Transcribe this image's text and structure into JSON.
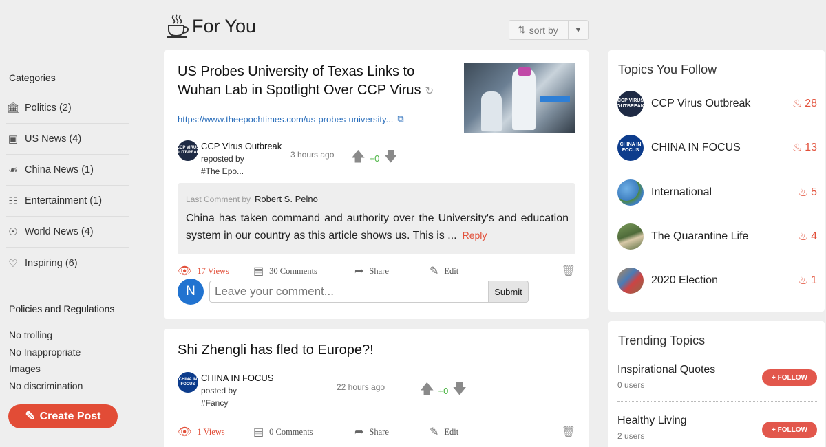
{
  "header": {
    "title": "For You",
    "sort_label": "sort by"
  },
  "sidebar": {
    "categories_title": "Categories",
    "categories": [
      {
        "label": "Politics (2)",
        "icon": "capitol-icon"
      },
      {
        "label": "US News (4)",
        "icon": "newspaper-icon"
      },
      {
        "label": "China News (1)",
        "icon": "chinese-map-icon"
      },
      {
        "label": "Entertainment (1)",
        "icon": "popcorn-icon"
      },
      {
        "label": "World News (4)",
        "icon": "globe-icon"
      },
      {
        "label": "Inspiring (6)",
        "icon": "heart-hand-icon"
      }
    ],
    "policies_title": "Policies and Regulations",
    "policies": [
      "No trolling",
      "No Inappropriate",
      "Images",
      "No discrimination"
    ],
    "create_post_label": "Create Post"
  },
  "posts": [
    {
      "title_line1": "US Probes University of Texas Links to",
      "title_line2": "Wuhan Lab in Spotlight Over CCP Virus",
      "link": "https://www.theepochtimes.com/us-probes-university...",
      "author": "CCP Virus Outbreak",
      "avatar_text": "CCP VIRUS OUTBREAK",
      "action": "reposted by",
      "by": "#The Epo...",
      "time": "3 hours ago",
      "score": "+0",
      "last_comment_label": "Last Comment by",
      "last_comment_author": "Robert S. Pelno",
      "last_comment_text": "China has taken command and authority over the University's and education system in our country as this article shows us. This is ...",
      "reply_label": "Reply",
      "views": "17 Views",
      "comments": "30 Comments",
      "share": "Share",
      "edit": "Edit",
      "comment_placeholder": "Leave your comment...",
      "submit_label": "Submit",
      "user_initial": "N"
    },
    {
      "title_line1": "Shi Zhengli has fled to Europe?!",
      "author": "CHINA IN FOCUS",
      "avatar_text": "CHINA IN FOCUS",
      "action": "posted by",
      "by": "#Fancy",
      "time": "22 hours ago",
      "score": "+0",
      "views": "1 Views",
      "comments": "0 Comments",
      "share": "Share",
      "edit": "Edit"
    }
  ],
  "topics_follow": {
    "title": "Topics You Follow",
    "items": [
      {
        "name": "CCP Virus Outbreak",
        "count": "28",
        "avatar_text": "CCP VIRUS OUTBREAK",
        "color": "#1e2a44"
      },
      {
        "name": "CHINA IN FOCUS",
        "count": "13",
        "avatar_text": "CHINA IN FOCUS",
        "color": "#0d3c8c"
      },
      {
        "name": "International",
        "count": "5",
        "avatar_text": "",
        "color": "#3f7fc0"
      },
      {
        "name": "The Quarantine Life",
        "count": "4",
        "avatar_text": "",
        "color": "#4f6b3a"
      },
      {
        "name": "2020 Election",
        "count": "1",
        "avatar_text": "",
        "color": "#8a6a4a"
      }
    ]
  },
  "trending": {
    "title": "Trending Topics",
    "items": [
      {
        "name": "Inspirational Quotes",
        "users": "0 users",
        "follow_label": "+ FOLLOW"
      },
      {
        "name": "Healthy Living",
        "users": "2 users",
        "follow_label": "+ FOLLOW"
      }
    ]
  },
  "colors": {
    "accent": "#e2503a",
    "link": "#2a6ebb",
    "upvote_score": "#4bb543",
    "user_avatar": "#2173d0"
  }
}
